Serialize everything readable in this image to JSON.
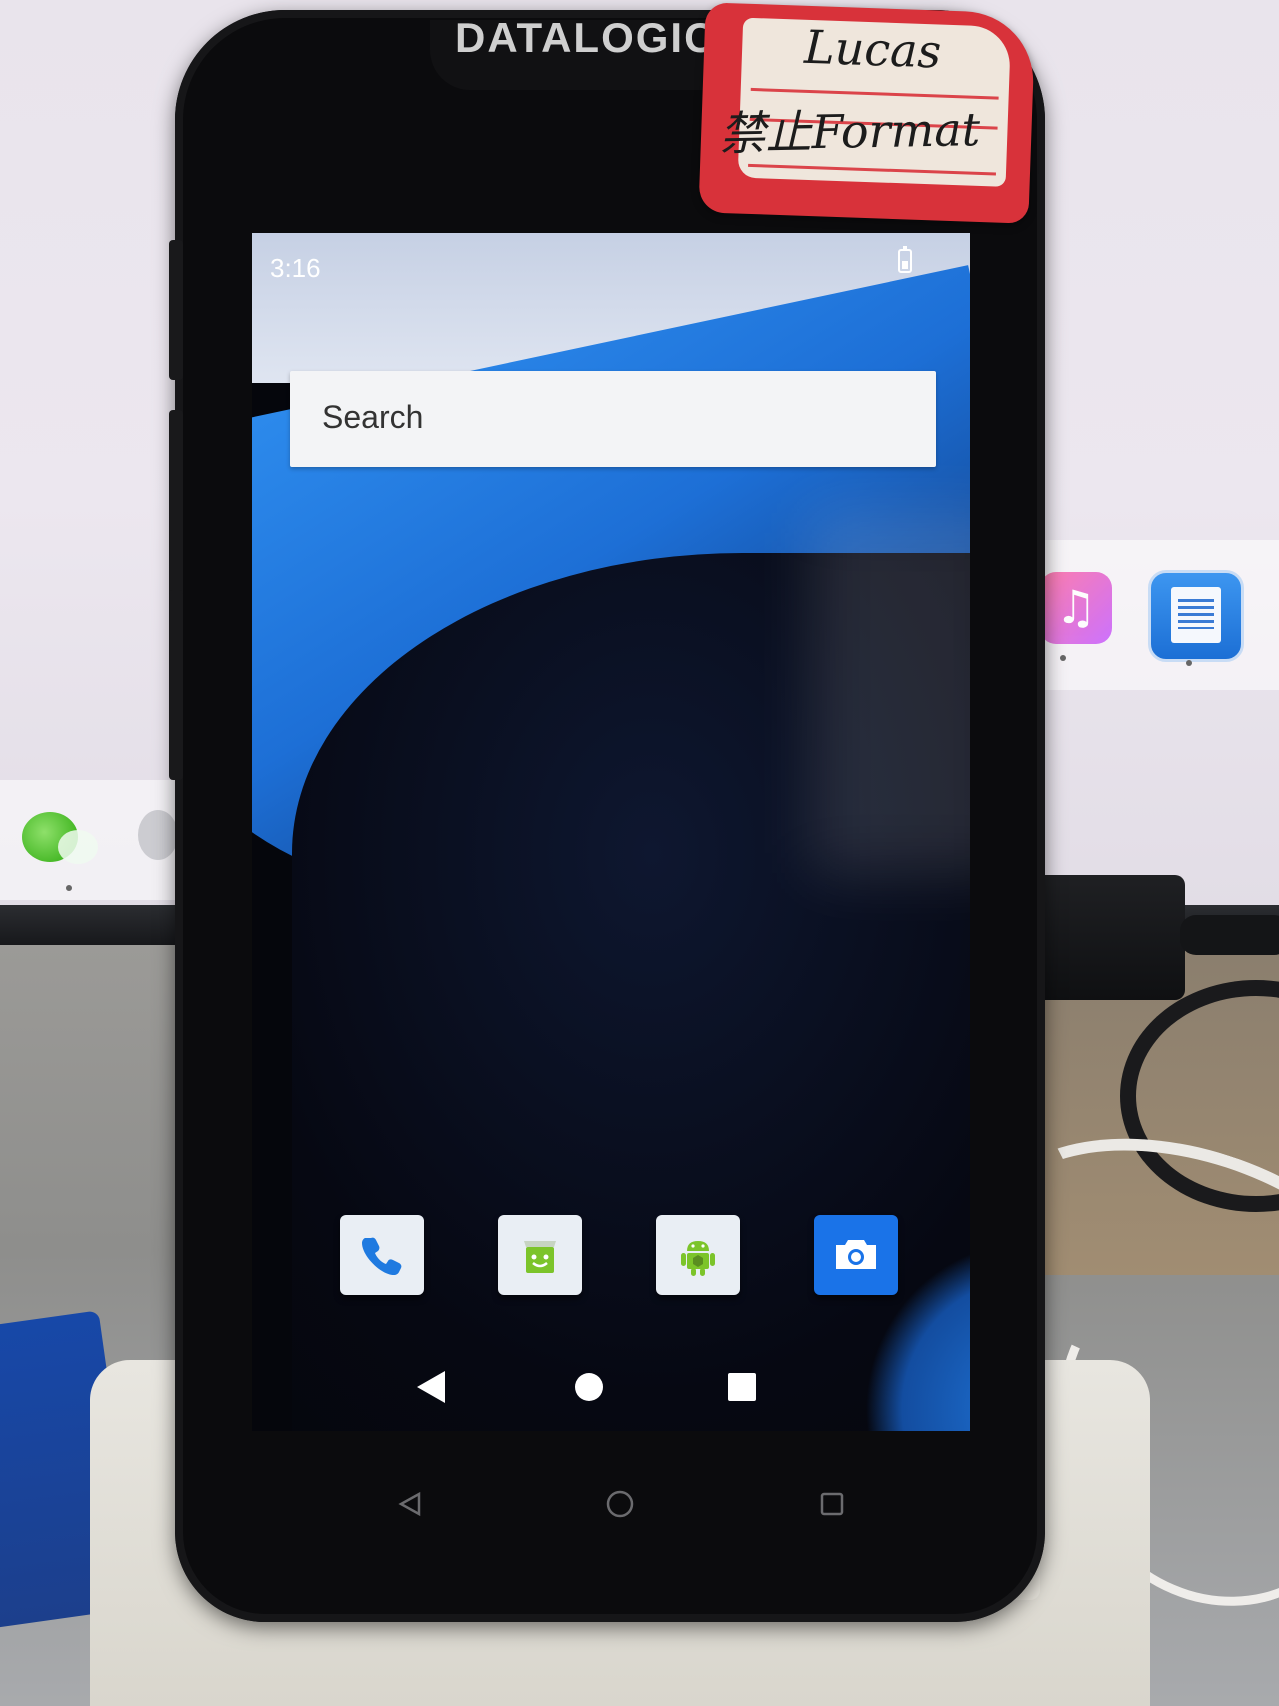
{
  "device": {
    "brand": "DATALOGIC"
  },
  "sticker": {
    "name": "Lucas",
    "note": "禁止Format"
  },
  "status_bar": {
    "time": "3:16",
    "battery_icon": "battery-icon"
  },
  "search": {
    "placeholder": "Search"
  },
  "dock": {
    "apps": [
      {
        "name": "Phone",
        "icon": "phone-icon",
        "color": "#e9eef4"
      },
      {
        "name": "Store",
        "icon": "shopping-bag-icon",
        "color": "#e9eef4"
      },
      {
        "name": "Android",
        "icon": "android-icon",
        "color": "#e9eef4"
      },
      {
        "name": "Camera",
        "icon": "camera-icon",
        "color": "#1a73e8"
      }
    ]
  },
  "nav_bar": {
    "buttons": [
      "back-icon",
      "home-icon",
      "recents-icon"
    ]
  },
  "colors": {
    "accent": "#1a73e8",
    "wallpaper_blue": "#2f8ff0",
    "sticker_red": "#d8323a"
  }
}
